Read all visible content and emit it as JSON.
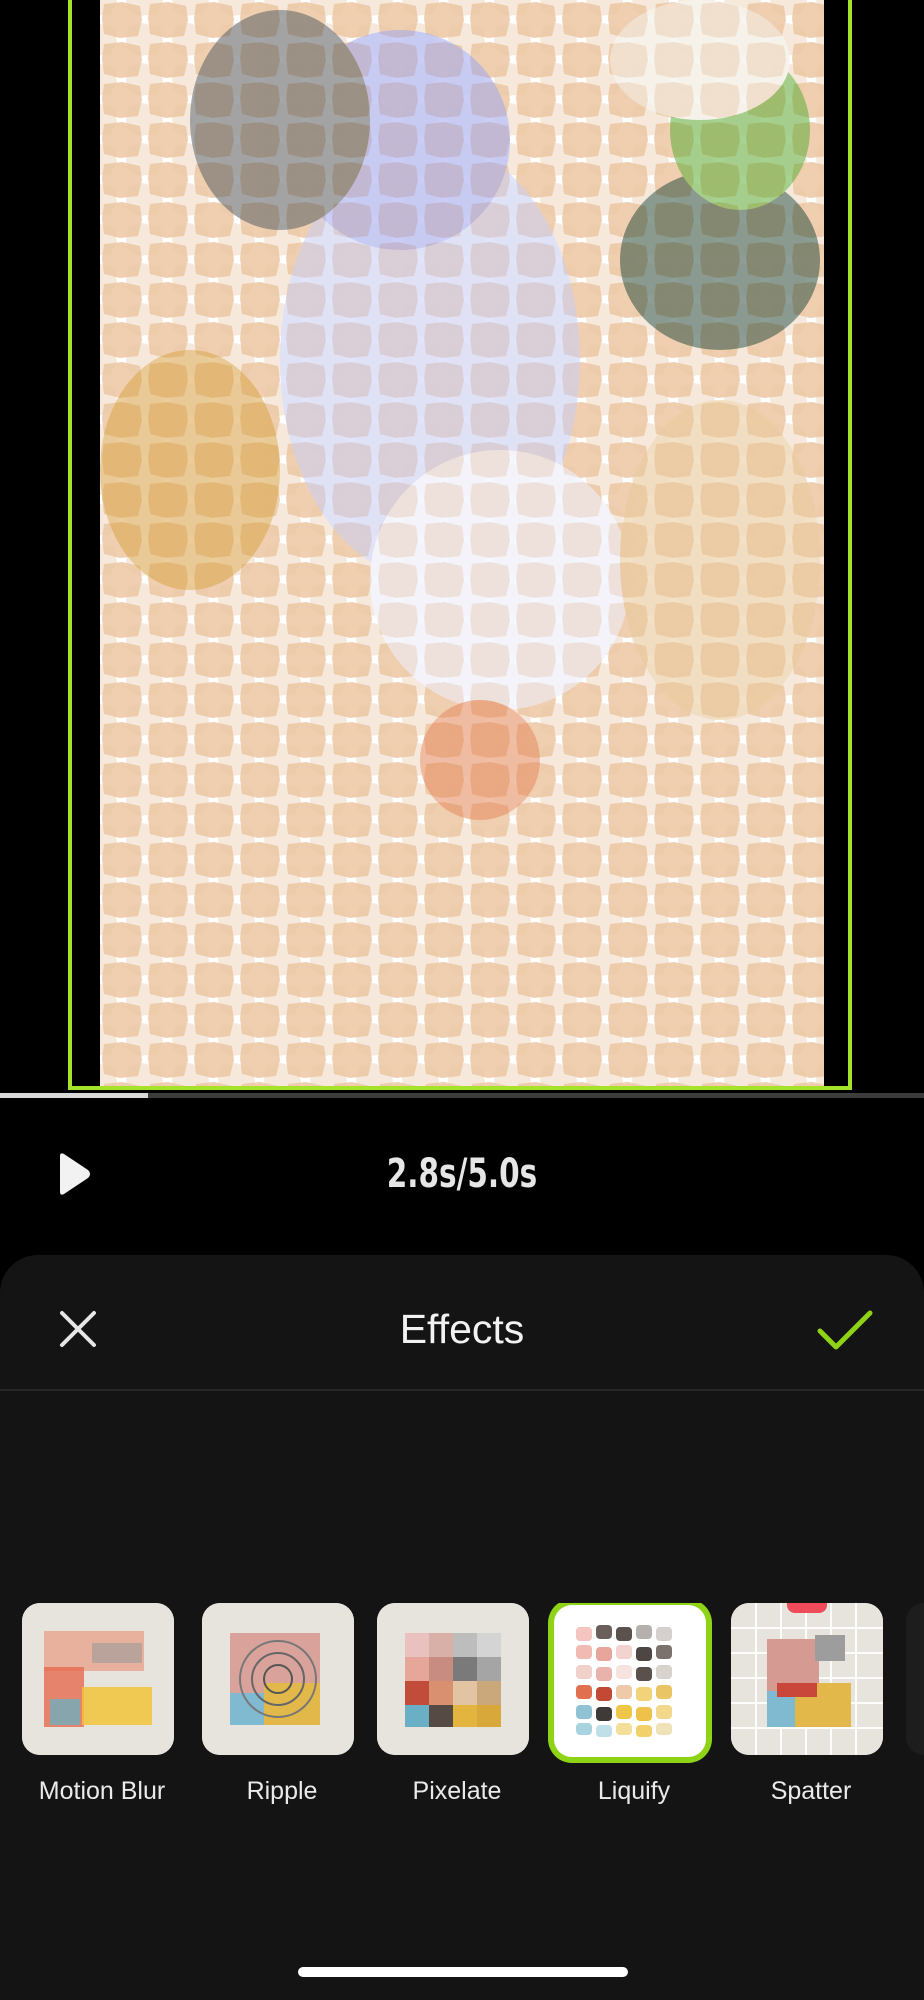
{
  "playback": {
    "time_display": "2.8s/5.0s",
    "progress": 0.16
  },
  "effects_panel": {
    "title": "Effects",
    "effects": [
      {
        "label": "Motion Blur",
        "selected": false,
        "premium": false
      },
      {
        "label": "Ripple",
        "selected": false,
        "premium": false
      },
      {
        "label": "Pixelate",
        "selected": false,
        "premium": false
      },
      {
        "label": "Liquify",
        "selected": true,
        "premium": false
      },
      {
        "label": "Spatter",
        "selected": false,
        "premium": true
      }
    ]
  },
  "colors": {
    "accent": "#8fd317",
    "frame_border": "#a6e22a",
    "panel_bg": "#141414",
    "premium_badge": "#ef4b5b"
  },
  "icons": {
    "play": "play-icon",
    "close": "close-icon",
    "confirm": "checkmark-icon",
    "premium": "crown-icon"
  }
}
